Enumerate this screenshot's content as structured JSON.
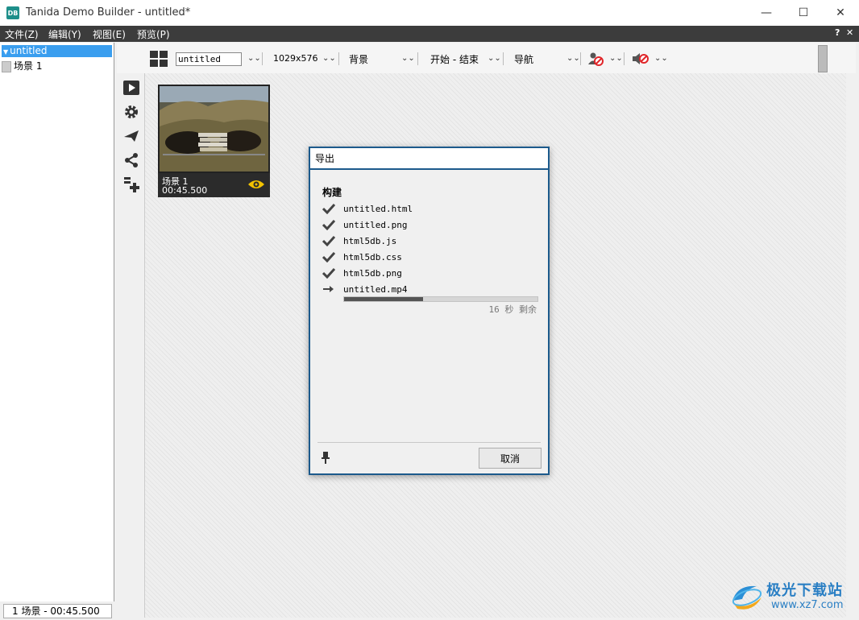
{
  "window": {
    "title": "Tanida Demo Builder - untitled*",
    "app_icon_text": "DB",
    "minimize_glyph": "—",
    "maximize_glyph": "☐",
    "close_glyph": "✕"
  },
  "menubar": {
    "items": [
      "文件(Z)",
      "编辑(Y)",
      "视图(E)",
      "预览(P)"
    ],
    "help_glyph": "?",
    "pin_glyph": "✕"
  },
  "tree": {
    "root": "untitled",
    "child": "场景 1"
  },
  "status": {
    "text": "1 场景 - 00:45.500"
  },
  "toolbar": {
    "project_name": "untitled",
    "resolution": "1029x576",
    "background": "背景",
    "start_end": "开始 - 结束",
    "navigation": "导航"
  },
  "scene": {
    "name": "场景 1",
    "duration": "00:45.500"
  },
  "dialog": {
    "title": "导出",
    "section": "构建",
    "files": [
      {
        "name": "untitled.html",
        "status": "done"
      },
      {
        "name": "untitled.png",
        "status": "done"
      },
      {
        "name": "html5db.js",
        "status": "done"
      },
      {
        "name": "html5db.css",
        "status": "done"
      },
      {
        "name": "html5db.png",
        "status": "done"
      },
      {
        "name": "untitled.mp4",
        "status": "in-progress"
      }
    ],
    "progress_fraction": 0.41,
    "remaining": "16 秒 剩余",
    "cancel_label": "取消"
  },
  "watermark": {
    "brand": "极光下载站",
    "url": "www.xz7.com"
  },
  "colors": {
    "accent": "#1c5a8c",
    "selection": "#3a9eef",
    "menubar": "#3c3c3c",
    "eye": "#f2c200",
    "no_sign": "#e0262a"
  }
}
